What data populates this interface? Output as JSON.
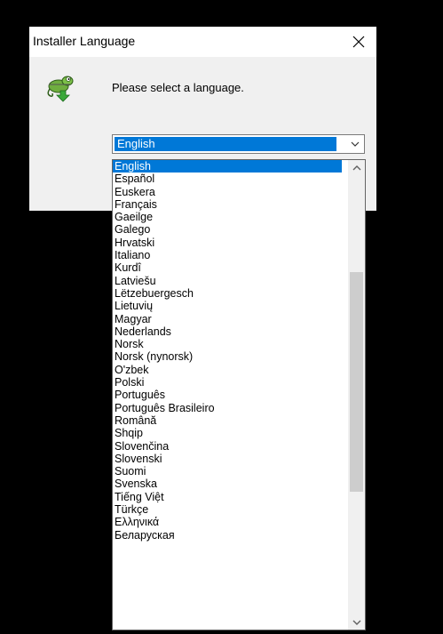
{
  "dialog": {
    "title": "Installer Language",
    "prompt": "Please select a language.",
    "icon": "installer-chameleon-icon",
    "close_icon": "close-icon"
  },
  "combo": {
    "selected": "English",
    "arrow_icon": "chevron-down-icon"
  },
  "languages": [
    "English",
    "Español",
    "Euskera",
    "Français",
    "Gaeilge",
    "Galego",
    "Hrvatski",
    "Italiano",
    "Kurdî",
    "Latviešu",
    "Lëtzebuergesch",
    "Lietuvių",
    "Magyar",
    "Nederlands",
    "Norsk",
    "Norsk (nynorsk)",
    "O'zbek",
    "Polski",
    "Português",
    "Português Brasileiro",
    "Română",
    "Shqip",
    "Slovenčina",
    "Slovenski",
    "Suomi",
    "Svenska",
    "Tiếng Việt",
    "Türkçe",
    "Ελληνικά",
    "Беларуская"
  ],
  "selected_index": 0,
  "scroll": {
    "thumb_start": 0.22,
    "thumb_end": 0.72
  },
  "colors": {
    "selection": "#0078d7",
    "dialog_bg": "#f0f0f0",
    "screen_bg": "#000000"
  }
}
